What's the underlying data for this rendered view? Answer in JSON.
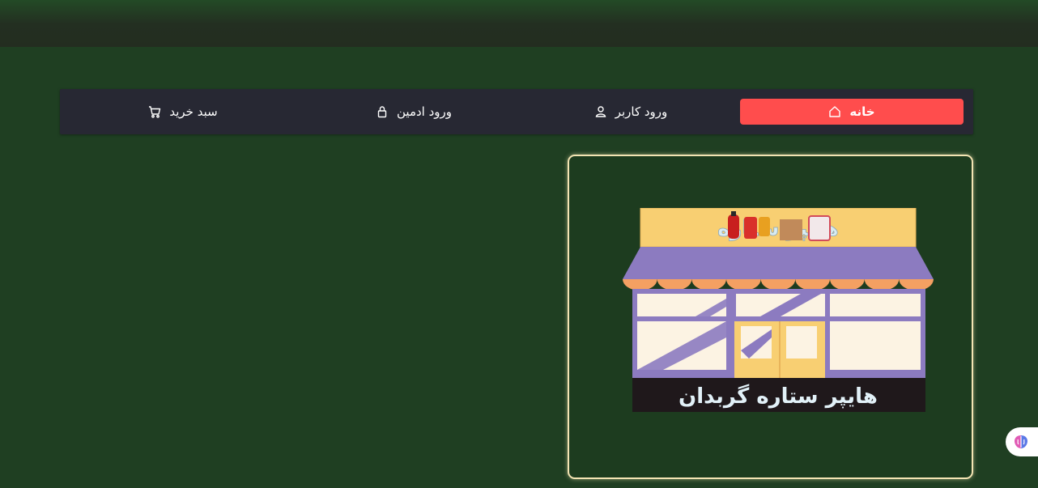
{
  "nav": {
    "items": [
      {
        "label": "خانه",
        "icon": "home-icon",
        "active": true
      },
      {
        "label": "ورود کاربر",
        "icon": "user-icon",
        "active": false
      },
      {
        "label": "ورود ادمین",
        "icon": "lock-icon",
        "active": false
      },
      {
        "label": "سبد خرید",
        "icon": "cart-icon",
        "active": false
      }
    ]
  },
  "store": {
    "sign_top": "هایپر ستاره",
    "sign_bottom": "هایپر ستاره گربدان"
  },
  "colors": {
    "background": "#1f3f22",
    "nav_bg": "#272833",
    "accent": "#ff4d4d",
    "card_border": "#f3e4b3"
  },
  "assistant_button": {
    "icon": "brain-icon"
  }
}
